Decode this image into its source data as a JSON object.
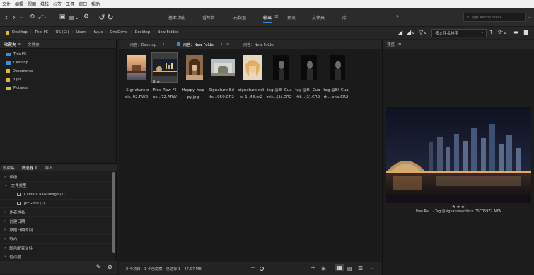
{
  "menu": [
    "文件",
    "编辑",
    "视图",
    "堆栈",
    "标签",
    "工具",
    "窗口",
    "帮助"
  ],
  "workspaces": [
    "基本功能",
    "看片台",
    "元数据",
    "输出",
    "预览",
    "文件夹",
    "库"
  ],
  "active_workspace": "输出",
  "search": {
    "placeholder": "搜索 Adobe Stock"
  },
  "breadcrumb": [
    "Desktop",
    "This PC",
    "OS (C:)",
    "Users",
    "fujus",
    "OneDrive",
    "Desktop",
    "New Folder"
  ],
  "sort": {
    "label": "按文件名排序"
  },
  "left_tabs": {
    "favorites": "收藏夹",
    "folders": "文件夹"
  },
  "favorites": [
    {
      "label": "This PC",
      "icon": "computer-icon",
      "color": "#3a8fd9"
    },
    {
      "label": "Desktop",
      "icon": "desktop-icon",
      "color": "#3a8fd9"
    },
    {
      "label": "Documents",
      "icon": "documents-icon",
      "color": "#e0b93a"
    },
    {
      "label": "fujus",
      "icon": "folder-icon",
      "color": "#e0b93a"
    },
    {
      "label": "Pictures",
      "icon": "pictures-icon",
      "color": "#e0b93a"
    }
  ],
  "filter_tabs": {
    "collections": "收藏集",
    "filter": "筛选器",
    "export": "导出"
  },
  "filters": [
    {
      "label": "评级",
      "expanded": false,
      "sub": false
    },
    {
      "label": "文件类型",
      "expanded": true,
      "sub": false
    },
    {
      "label": "Camera Raw image (7)",
      "sub": true
    },
    {
      "label": "JPEG file (1)",
      "sub": true
    },
    {
      "label": "作者姓名",
      "expanded": false,
      "sub": false
    },
    {
      "label": "创建日期",
      "expanded": false,
      "sub": false
    },
    {
      "label": "原始日期时间",
      "expanded": false,
      "sub": false
    },
    {
      "label": "取向",
      "expanded": false,
      "sub": false
    },
    {
      "label": "颜色配置文件",
      "expanded": false,
      "sub": false
    },
    {
      "label": "位深度",
      "expanded": false,
      "sub": false
    }
  ],
  "content_tabs": [
    "内容：Desktop",
    "内容：New Folder",
    "内容：New Folder"
  ],
  "files": [
    {
      "name1": "_Signature e",
      "name2": "dit..92.RW2",
      "thumb": "sunset-pier"
    },
    {
      "name1": "Free Raw Fil",
      "name2": "es...72.ARW",
      "thumb": "city-night",
      "selected": true,
      "rating": "3 ★"
    },
    {
      "name1": "Happy_hap",
      "name2": "py.jpg",
      "thumb": "portrait-woman"
    },
    {
      "name1": "Signature Ed",
      "name2": "its...959.CR2",
      "thumb": "arch-landscape"
    },
    {
      "name1": "signature edi",
      "name2": "ts-1..48.cr2",
      "thumb": "blonde-portrait"
    },
    {
      "name1": "tag @El_Cua",
      "name2": "rtit...(1).CR2",
      "thumb": "dark-portrait"
    },
    {
      "name1": "tag @El_Cua",
      "name2": "rtit...(2).CR2",
      "thumb": "dark-portrait"
    },
    {
      "name1": "tag @El_Cua",
      "name2": "rti...ona.CR2",
      "thumb": "dark-portrait"
    }
  ],
  "status": "8 个项目，1 个已隐藏，已选择 1 - 47.07 MB",
  "preview": {
    "title": "预览",
    "stars": "★★★",
    "caption": "Free Ra... - Tag @signatureeditsco DSC05972.ARW"
  },
  "colors": {
    "accent": "#2d8ceb",
    "bg": "#1e1e1e"
  }
}
